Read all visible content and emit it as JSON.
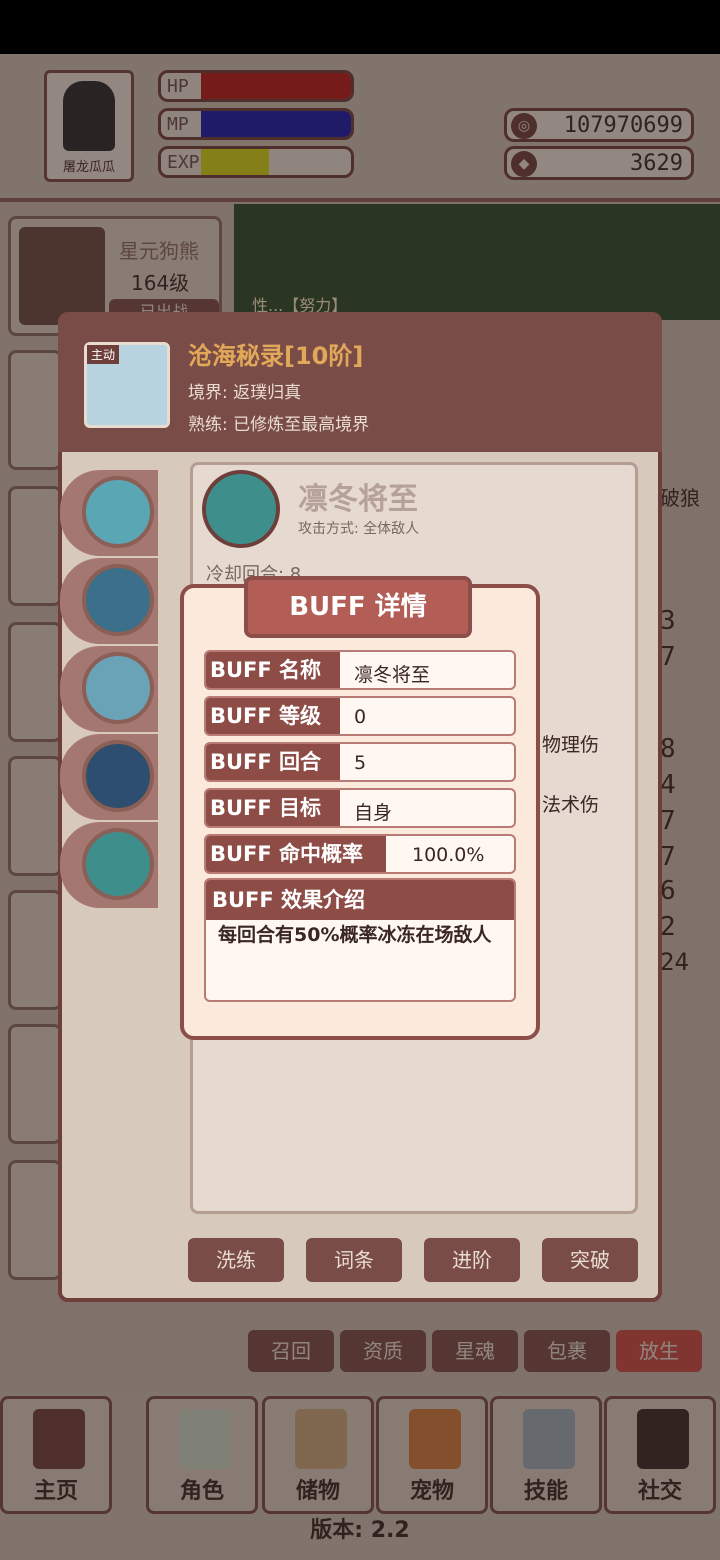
{
  "player": {
    "name": "屠龙瓜瓜",
    "bars": [
      {
        "label": "HP",
        "color": "#b51a1a",
        "fill": 1.0
      },
      {
        "label": "MP",
        "color": "#1a1aa8",
        "fill": 1.0
      },
      {
        "label": "EXP",
        "color": "#cfcf14",
        "fill": 0.45
      }
    ],
    "coins": "107970699",
    "gems": "3629"
  },
  "pet_card": {
    "name": "星元狗熊",
    "level": "164级",
    "status": "已出战"
  },
  "scene_text": "性...【努力】",
  "skill": {
    "badge": "主动",
    "title": "沧海秘录[10阶]",
    "realm": "境界: 返璞归真",
    "proficiency": "熟练: 已修炼至最高境界"
  },
  "content": {
    "name": "凛冬将至",
    "attack": "攻击方式: 全体敌人",
    "cooldown": "冷却回合: 8",
    "right_snippets": [
      "破狼",
      "物理伤",
      "法术伤"
    ],
    "right_numbers": [
      "3",
      "7",
      "8",
      "4",
      "7",
      "7",
      "6",
      "2",
      "24"
    ]
  },
  "actions": [
    "洗练",
    "词条",
    "进阶",
    "突破"
  ],
  "bottom_actions": [
    "召回",
    "资质",
    "星魂",
    "包裹",
    "放生"
  ],
  "dialog": {
    "title": "BUFF 详情",
    "rows": [
      {
        "label": "BUFF 名称",
        "value": "凛冬将至"
      },
      {
        "label": "BUFF 等级",
        "value": "0"
      },
      {
        "label": "BUFF 回合",
        "value": "5"
      },
      {
        "label": "BUFF 目标",
        "value": "自身"
      },
      {
        "label": "BUFF 命中概率",
        "value": "100.0%"
      }
    ],
    "effect_label": "BUFF 效果介绍",
    "effect_text": "每回合有50%概率冰冻在场敌人"
  },
  "nav": [
    "主页",
    "角色",
    "储物",
    "宠物",
    "技能",
    "社交"
  ],
  "version": "版本: 2.2",
  "colors": {
    "panel": "#7a4c47",
    "dialog_bg": "#fbe9dc",
    "accent_gold": "#e2a85a"
  }
}
